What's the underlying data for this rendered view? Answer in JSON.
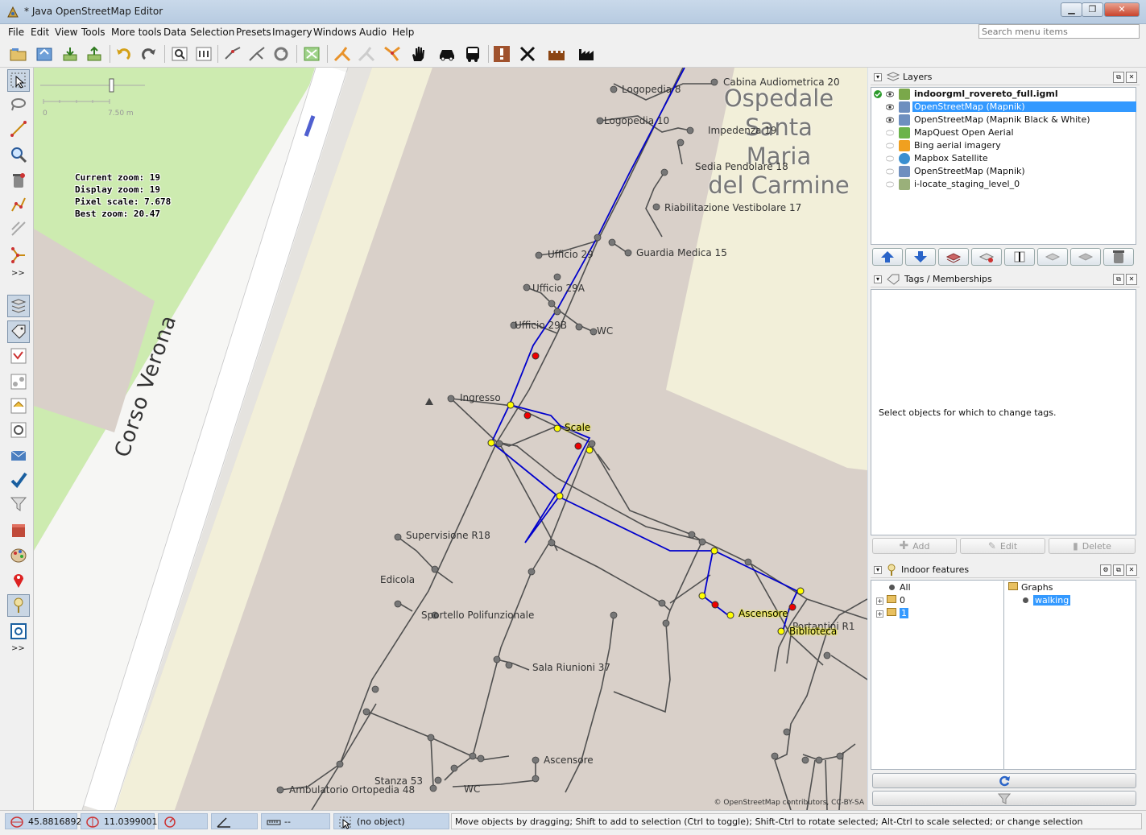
{
  "window": {
    "title": "* Java OpenStreetMap Editor",
    "minimize": "▁",
    "maximize": "❐",
    "close": "✕"
  },
  "menu": {
    "items": [
      "File",
      "Edit",
      "View",
      "Tools",
      "More tools",
      "Data",
      "Selection",
      "Presets",
      "Imagery",
      "Windows",
      "Audio",
      "Help"
    ],
    "search_placeholder": "Search menu items"
  },
  "left_tools": {
    "more_top": ">>",
    "more_bottom": ">>"
  },
  "map": {
    "zoom_info": [
      "Current zoom: 19",
      "Display zoom: 19",
      "Pixel scale: 7.678",
      "Best zoom: 20.47"
    ],
    "scale_zero": "0",
    "scale_length": "7.50 m",
    "street_label": "Corso Verona",
    "hospital_label": [
      "Ospedale",
      "Santa",
      "Maria",
      "del Carmine"
    ],
    "attribution": "© OpenStreetMap contributors, CC-BY-SA",
    "labels": {
      "cabina": "Cabina Audiometrica 20",
      "logopedia8": "Logopedia 8",
      "logopedia10": "Logopedia 10",
      "impedenza": "Impedenza 19",
      "sedia": "Sedia Pendolare 18",
      "riabilitazione": "Riabilitazione Vestibolare 17",
      "ufficio29": "Ufficio 29",
      "guardia": "Guardia Medica 15",
      "ufficio29a": "Ufficio 29A",
      "ufficio29b": "Ufficio 29B",
      "wc1": "WC",
      "ingresso": "Ingresso",
      "scale": "Scale",
      "supervisione": "Supervisione R18",
      "edicola": "Edicola",
      "sportello": "Sportello Polifunzionale",
      "ascensore1": "Ascensore",
      "portantini": "Portantini R1",
      "biblioteca": "Biblioteca",
      "sala": "Sala Riunioni 37",
      "ascensore2": "Ascensore",
      "stanza": "Stanza 53",
      "wc2": "WC",
      "ambulatorio": "Ambulatorio Ortopedia 48"
    }
  },
  "layers_panel": {
    "title": "Layers",
    "layers": [
      {
        "name": "indoorgml_rovereto_full.igml",
        "visible": true,
        "active": true,
        "selected": false,
        "color": "#7aa84a"
      },
      {
        "name": "OpenStreetMap (Mapnik)",
        "visible": true,
        "active": false,
        "selected": true,
        "color": "#6e8fbf"
      },
      {
        "name": "OpenStreetMap (Mapnik Black & White)",
        "visible": true,
        "active": false,
        "selected": false,
        "color": "#6e8fbf"
      },
      {
        "name": "MapQuest Open Aerial",
        "visible": false,
        "active": false,
        "selected": false,
        "color": "#6bb34a"
      },
      {
        "name": "Bing aerial imagery",
        "visible": false,
        "active": false,
        "selected": false,
        "color": "#f0a020"
      },
      {
        "name": "Mapbox Satellite",
        "visible": false,
        "active": false,
        "selected": false,
        "color": "#3a8fd0"
      },
      {
        "name": "OpenStreetMap (Mapnik)",
        "visible": false,
        "active": false,
        "selected": false,
        "color": "#6e8fbf"
      },
      {
        "name": "i-locate_staging_level_0",
        "visible": false,
        "active": false,
        "selected": false,
        "color": "#9ab07a"
      }
    ]
  },
  "tags_panel": {
    "title": "Tags / Memberships",
    "empty_message": "Select objects for which to change tags.",
    "add_label": "Add",
    "edit_label": "Edit",
    "delete_label": "Delete"
  },
  "indoor_panel": {
    "title": "Indoor features",
    "tree_all": "All",
    "tree_level0": "0",
    "tree_level1": "1",
    "graphs_label": "Graphs",
    "walking_label": "walking"
  },
  "statusbar": {
    "lat": "45.8816892",
    "lon": "11.0399001",
    "heading": "",
    "angle": "",
    "distance": "--",
    "object": "(no object)",
    "message": "Move objects by dragging; Shift to add to selection (Ctrl to toggle); Shift-Ctrl to rotate selected; Alt-Ctrl to scale selected; or change selection"
  },
  "colors": {
    "accent_selection": "#3399ff",
    "graph_path": "#0000cc",
    "grass": "#cdebb0",
    "building": "#d9d0c9",
    "hospital_area": "#f2efd9"
  }
}
